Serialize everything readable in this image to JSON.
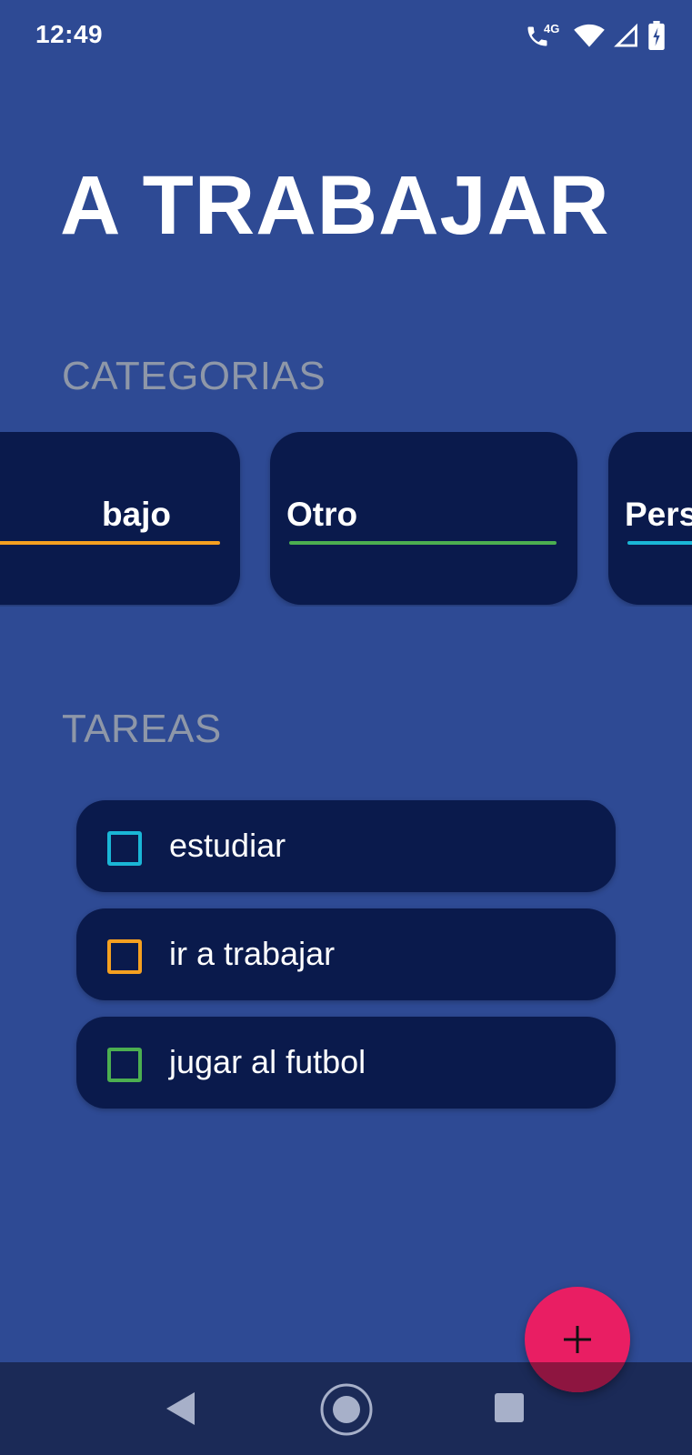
{
  "status_bar": {
    "time": "12:49",
    "network_label": "4G",
    "icons": [
      "wifi-calling-icon",
      "wifi-icon",
      "cell-signal-icon",
      "battery-charging-icon"
    ]
  },
  "header": {
    "title": "A TRABAJAR"
  },
  "categories": {
    "label": "CATEGORIAS",
    "items": [
      {
        "name": "bajo",
        "color": "#f5a020"
      },
      {
        "name": "Otro",
        "color": "#4caf50"
      },
      {
        "name": "Pers",
        "color": "#1ab6d6"
      }
    ]
  },
  "tasks": {
    "label": "TAREAS",
    "items": [
      {
        "text": "estudiar",
        "color": "#1ab6d6"
      },
      {
        "text": "ir a trabajar",
        "color": "#f5a020"
      },
      {
        "text": "jugar al futbol",
        "color": "#4caf50"
      }
    ]
  },
  "fab": {
    "icon": "plus-icon",
    "color": "#e91e63"
  },
  "nav_bar": {
    "buttons": [
      "back-icon",
      "home-icon",
      "recents-icon"
    ]
  }
}
